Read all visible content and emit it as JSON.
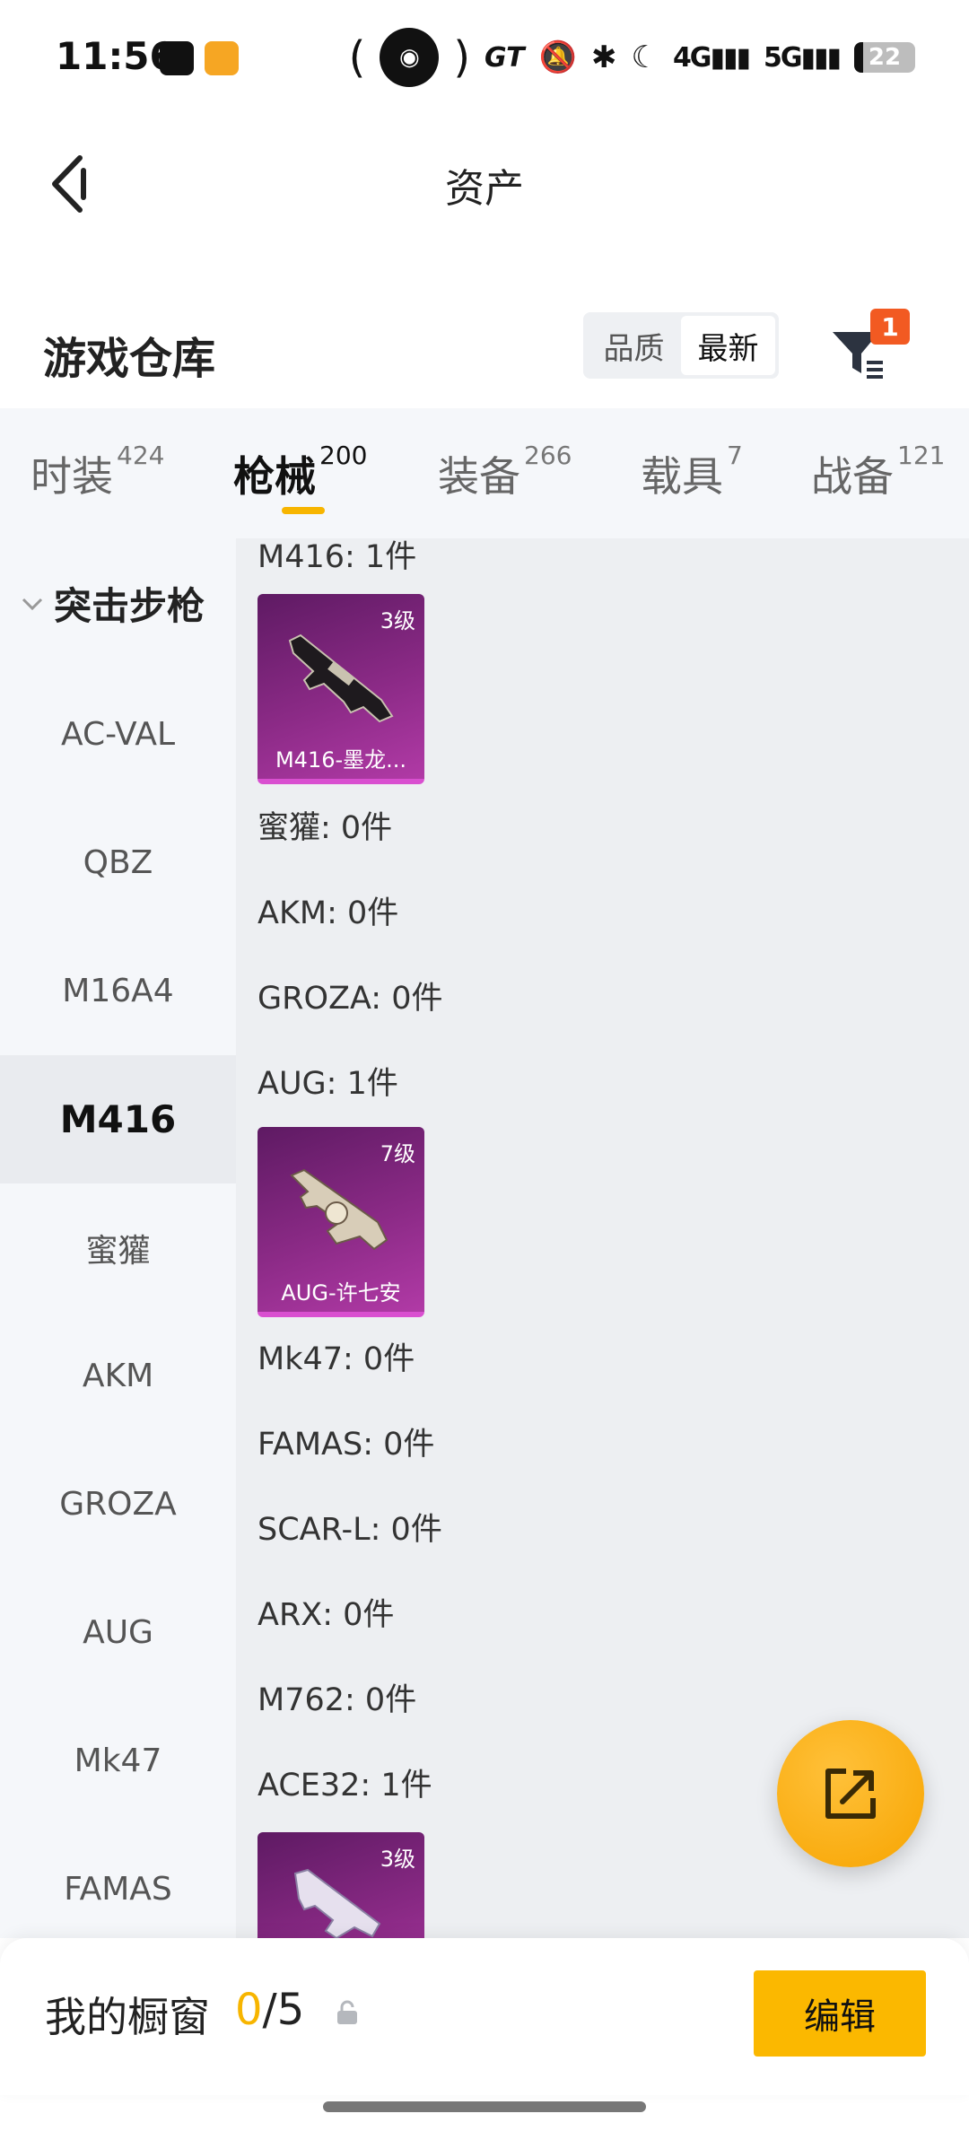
{
  "status_bar": {
    "time": "11:56",
    "network_4g": "4G",
    "network_5g": "5G",
    "battery": "22",
    "icons": [
      "tiktok-icon",
      "video-app-icon",
      "hotspot-icon",
      "gt-icon",
      "mute-icon",
      "bluetooth-icon",
      "moon-icon",
      "signal-icon",
      "battery-icon"
    ]
  },
  "header": {
    "title": "资产",
    "back_icon": "chevron-left-icon"
  },
  "warehouse": {
    "title": "游戏仓库",
    "sort_options": [
      "品质",
      "最新"
    ],
    "sort_selected": "最新",
    "filter_badge": "1"
  },
  "tabs": [
    {
      "label": "时装",
      "count": "424"
    },
    {
      "label": "枪械",
      "count": "200"
    },
    {
      "label": "装备",
      "count": "266"
    },
    {
      "label": "载具",
      "count": "7"
    },
    {
      "label": "战备",
      "count": "121"
    }
  ],
  "active_tab": "枪械",
  "sidebar": {
    "group": "突击步枪",
    "items": [
      "AC-VAL",
      "QBZ",
      "M16A4",
      "M416",
      "蜜獾",
      "AKM",
      "GROZA",
      "AUG",
      "Mk47",
      "FAMAS"
    ],
    "active": "M416"
  },
  "content": {
    "rows": [
      "M416: 1件",
      "蜜獾: 0件",
      "AKM: 0件",
      "GROZA: 0件",
      "AUG: 1件",
      "Mk47: 0件",
      "FAMAS: 0件",
      "SCAR-L: 0件",
      "ARX: 0件",
      "M762: 0件",
      "ACE32: 1件"
    ],
    "cards": [
      {
        "name": "M416-墨龙...",
        "level": "3级"
      },
      {
        "name": "AUG-许七安",
        "level": "7级"
      },
      {
        "name": "",
        "level": "3级"
      }
    ]
  },
  "bottom_bar": {
    "label": "我的橱窗",
    "count_current": "0",
    "count_total": "/5",
    "edit_label": "编辑"
  },
  "colors": {
    "accent": "#f7b500",
    "badge": "#f25a22",
    "card_purple": "#8b2a86"
  }
}
